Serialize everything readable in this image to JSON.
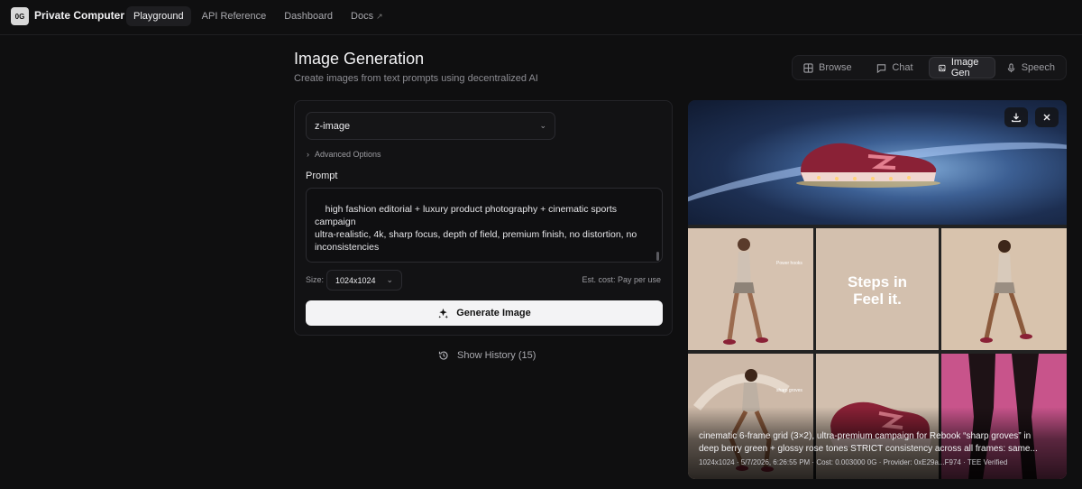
{
  "app": {
    "logo": "0G",
    "name": "Private Computer"
  },
  "nav": [
    {
      "label": "Playground",
      "active": true
    },
    {
      "label": "API Reference",
      "active": false
    },
    {
      "label": "Dashboard",
      "active": false
    },
    {
      "label": "Docs",
      "active": false,
      "external": true
    }
  ],
  "header": {
    "title": "Image Generation",
    "subtitle": "Create images from text prompts using decentralized AI"
  },
  "tabs": [
    {
      "label": "Browse",
      "icon": "grid-icon",
      "active": false
    },
    {
      "label": "Chat",
      "icon": "chat-icon",
      "active": false
    },
    {
      "label": "Image Gen",
      "icon": "image-icon",
      "active": true
    },
    {
      "label": "Speech",
      "icon": "mic-icon",
      "active": false
    }
  ],
  "form": {
    "model": "z-image",
    "advanced_label": "Advanced Options",
    "prompt_label": "Prompt",
    "prompt_text": "high fashion editorial + luxury product photography + cinematic sports campaign\nultra-realistic, 4k, sharp focus, depth of field, premium finish, no distortion, no inconsistencies\n\nOPTIONAL TEXT OVERLAY (minimal, clean typography):\n“Power hooks” / “Steps in” / “Feel it.”",
    "size_label": "Size:",
    "size_value": "1024x1024",
    "cost_label": "Est. cost: Pay per use",
    "generate_label": "Generate Image"
  },
  "history": {
    "label": "Show History (15)"
  },
  "result": {
    "caption": "cinematic 6-frame grid (3×2), ultra-premium campaign for Rebook “sharp groves” in deep berry green + glossy rose tones STRICT consistency across all frames: same...",
    "meta": "1024x1024 · 5/7/2026, 6:26:55 PM · Cost: 0.003000 0G · Provider: 0xE29a...F974 · TEE Verified",
    "overlay_main": "Steps in\nFeel it.",
    "overlay_tag_1": "Power hooks",
    "overlay_tag_2": "sharp groves"
  },
  "colors": {
    "accent_shoe": "#8a2136",
    "background": "#0f0f10"
  }
}
